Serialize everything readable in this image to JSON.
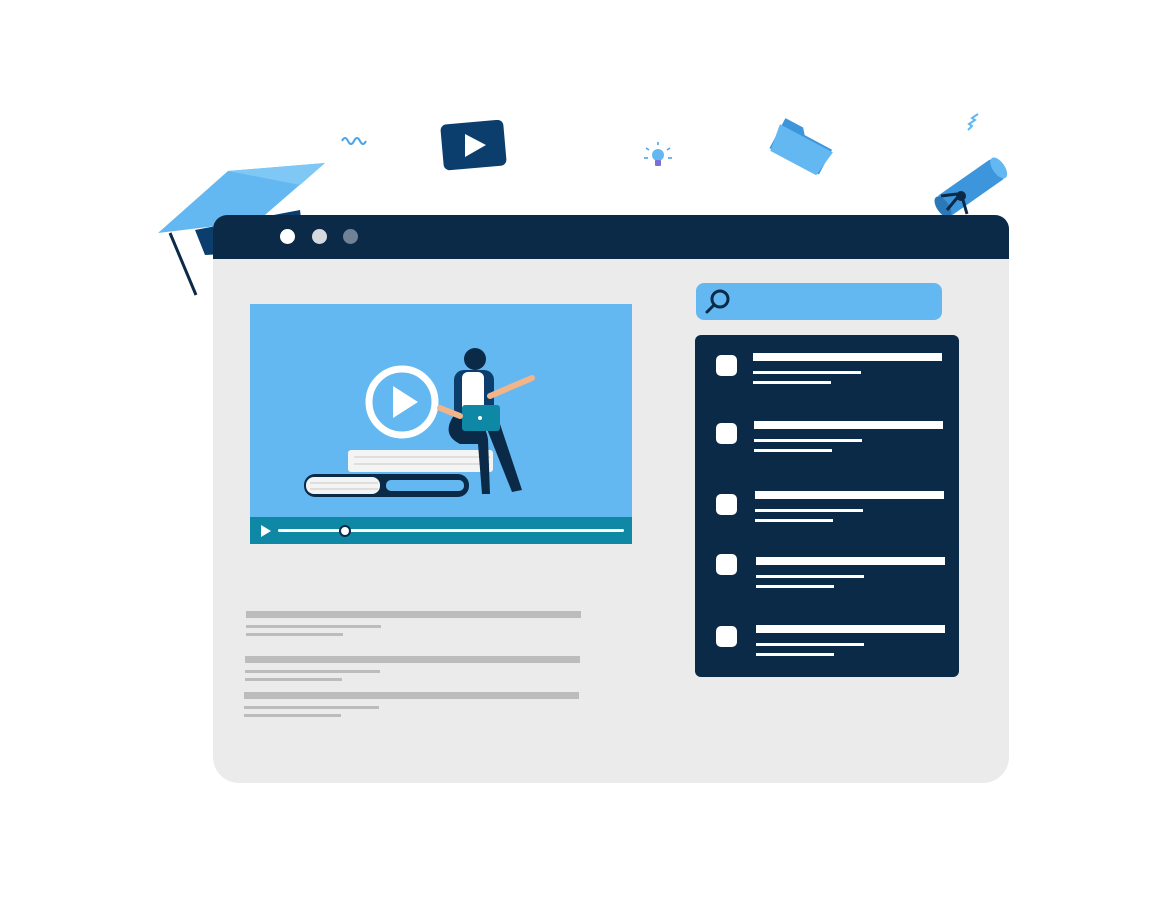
{
  "window": {
    "colors": {
      "frame": "#0b2a48",
      "body": "#ebebeb",
      "accent": "#63b8f1",
      "player_bar": "#0f88a6"
    },
    "titlebar_dots": [
      {
        "name": "window-dot-1",
        "color": "#ffffff"
      },
      {
        "name": "window-dot-2",
        "color": "#d5d8dc"
      },
      {
        "name": "window-dot-3",
        "color": "#6f8296"
      }
    ]
  },
  "video": {
    "play_icon": "play-circle-icon",
    "progress": 0.19
  },
  "search": {
    "icon": "search-icon",
    "value": "",
    "placeholder": ""
  },
  "list": {
    "items": 5,
    "icon": "checkbox-icon"
  },
  "decorations": [
    "graduation-cap-icon",
    "youtube-play-icon",
    "lightbulb-icon",
    "folder-icon",
    "diploma-scroll-icon"
  ]
}
